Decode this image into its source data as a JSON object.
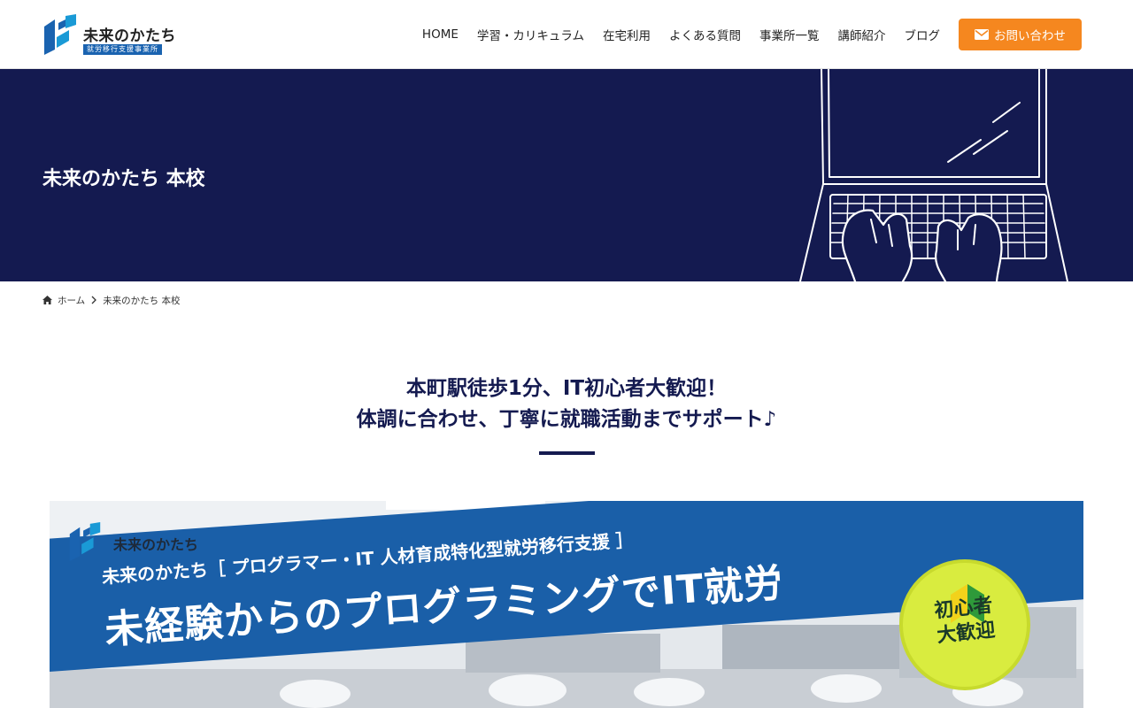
{
  "header": {
    "logo": {
      "title": "未来のかたち",
      "subtitle": "就労移行支援事業所"
    },
    "nav": [
      {
        "label": "HOME"
      },
      {
        "label": "学習・カリキュラム"
      },
      {
        "label": "在宅利用"
      },
      {
        "label": "よくある質問"
      },
      {
        "label": "事業所一覧"
      },
      {
        "label": "講師紹介"
      },
      {
        "label": "ブログ"
      }
    ],
    "contact_button": {
      "label": "お問い合わせ",
      "icon": "mail-icon",
      "color": "#f5871f"
    }
  },
  "hero": {
    "title": "未来のかたち 本校",
    "background": "#141a50"
  },
  "breadcrumb": {
    "home": "ホーム",
    "current": "未来のかたち 本校"
  },
  "lead": {
    "line1": "本町駅徒歩1分、IT初心者大歓迎！",
    "line2": "体調に合わせ、丁寧に就職活動までサポート♪"
  },
  "banner": {
    "logo_text": "未来のかたち",
    "subtitle": "未来のかたち［ プログラマー・IT 人材育成特化型就労移行支援 ］",
    "headline": "未経験からのプログラミングでIT就労",
    "badge_line1": "初心者",
    "badge_line2": "大歓迎"
  }
}
